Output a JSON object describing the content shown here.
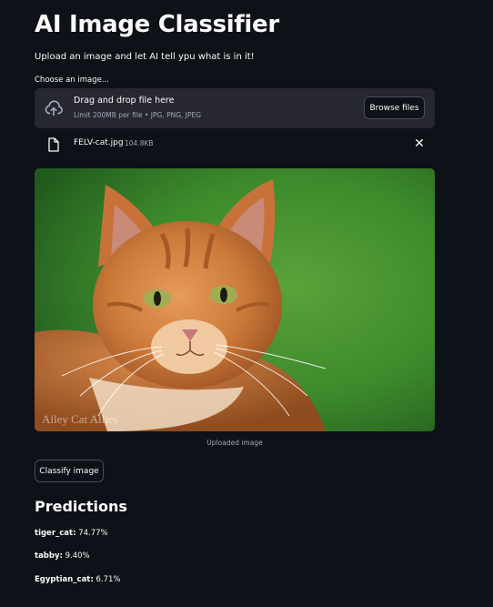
{
  "app": {
    "title": "AI Image Classifier",
    "subtitle": "Upload an image and let AI tell ypu what is in it!"
  },
  "uploader": {
    "label": "Choose an image...",
    "drop_title": "Drag and drop file here",
    "limit_text": "Limit 200MB per file • JPG, PNG, JPEG",
    "browse_label": "Browse files",
    "icon": "cloud-upload-icon"
  },
  "file": {
    "name": "FELV-cat.jpg",
    "size": "104.8KB",
    "icon": "file-icon",
    "remove_icon": "close-icon"
  },
  "image": {
    "caption": "Uploaded image",
    "watermark": "Alley Cat Allies"
  },
  "classify_button": "Classify image",
  "predictions": {
    "heading": "Predictions",
    "items": [
      {
        "label": "tiger_cat",
        "value": "74.77%"
      },
      {
        "label": "tabby",
        "value": "9.40%"
      },
      {
        "label": "Egyptian_cat",
        "value": "6.71%"
      }
    ]
  },
  "colors": {
    "background": "#0e1117",
    "dropzone": "#262730",
    "text": "#fafafa",
    "muted_text": "#a3a8b8"
  }
}
